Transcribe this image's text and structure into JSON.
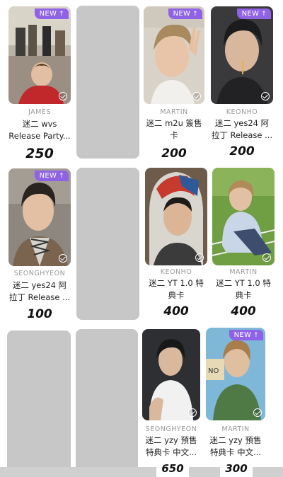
{
  "badge_text": "NEW",
  "colors": {
    "badge": "#8f62e6",
    "placeholder": "#c7c7c7",
    "member_text": "#9a9a9a"
  },
  "cards": [
    {
      "member": "JAMES",
      "title_line1": "迷二 wvs",
      "title_line2": "Release Party...",
      "price": "250",
      "new": true
    },
    {
      "member": "MARTIN",
      "title_line1": "迷二 m2u 簽售",
      "title_line2": "卡",
      "price": "200",
      "new": true
    },
    {
      "member": "KEONHO",
      "title_line1": "迷二 yes24 阿",
      "title_line2": "拉丁 Release ...",
      "price": "200",
      "new": true
    },
    {
      "member": "SEONGHYEON",
      "title_line1": "迷二 yes24 阿",
      "title_line2": "拉丁 Release ...",
      "price": "100",
      "new": true
    },
    {
      "member": "KEONHO",
      "title_line1": "迷二 YT 1.0 特",
      "title_line2": "典卡",
      "price": "400",
      "new": false
    },
    {
      "member": "MARTIN",
      "title_line1": "迷二 YT 1.0 特",
      "title_line2": "典卡",
      "price": "400",
      "new": false
    },
    {
      "member": "SEONGHYEON",
      "title_line1": "迷二 yzy 預售",
      "title_line2": "特典卡 中文...",
      "price": "650",
      "new": false
    },
    {
      "member": "MARTIN",
      "title_line1": "迷二 yzy 預售",
      "title_line2": "特典卡 中文...",
      "price": "300",
      "new": true
    }
  ]
}
